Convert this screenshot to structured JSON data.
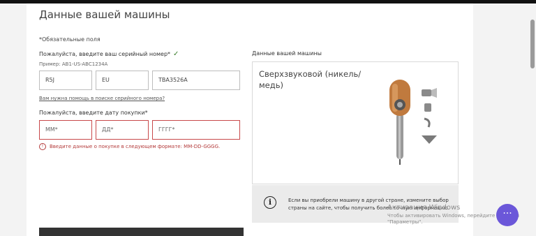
{
  "section_title": "Данные вашей машины",
  "required_note": "*Обязательные поля",
  "serial": {
    "label": "Пожалуйста, введите ваш серийный номер*",
    "example": "Пример: AB1-US-ABC1234A",
    "part1": "R5J",
    "part2": "EU",
    "part3": "TBA3526A",
    "help_link": "Вам нужна помощь в поиске серийного номера?"
  },
  "purchase_date": {
    "label": "Пожалуйста, введите дату покупки*",
    "month_placeholder": "ММ*",
    "day_placeholder": "ДД*",
    "year_placeholder": "ГГГГ*",
    "error": "Введите данные о покупке в следующем формате: MM-DD-GGGG."
  },
  "machine_panel": {
    "label": "Данные вашей машины",
    "model_name": "Сверхзвуковой (никель/медь)",
    "info_text": "Если вы приобрели машину в другой стране, измените выбор страны на сайте, чтобы получить более точную информацию."
  },
  "windows_watermark": {
    "title": "Активация Windows",
    "subtitle": "Чтобы активировать Windows, перейдите в раздел \"Параметры\"."
  },
  "chat_button_glyph": "···",
  "colors": {
    "error": "#c8484a",
    "check": "#3b7d2d",
    "copper": "#c07a3e",
    "nickel": "#8c8c8c",
    "chat_button": "#6b57d9"
  }
}
